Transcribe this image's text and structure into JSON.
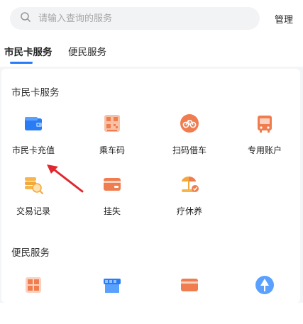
{
  "search": {
    "placeholder": "请输入查询的服务"
  },
  "header": {
    "manage_label": "管理"
  },
  "tabs": [
    {
      "label": "市民卡服务",
      "active": true
    },
    {
      "label": "便民服务",
      "active": false
    }
  ],
  "sections": [
    {
      "title": "市民卡服务",
      "items": [
        {
          "label": "市民卡充值",
          "icon": "wallet-icon"
        },
        {
          "label": "乘车码",
          "icon": "qr-code-icon"
        },
        {
          "label": "扫码借车",
          "icon": "bicycle-icon"
        },
        {
          "label": "专用账户",
          "icon": "bus-icon"
        },
        {
          "label": "交易记录",
          "icon": "coin-search-icon"
        },
        {
          "label": "挂失",
          "icon": "card-icon"
        },
        {
          "label": "疗休养",
          "icon": "beach-icon"
        }
      ]
    },
    {
      "title": "便民服务",
      "items": [
        {
          "label": "",
          "icon": "grid-icon"
        },
        {
          "label": "",
          "icon": "shop-icon"
        },
        {
          "label": "",
          "icon": "card-icon"
        },
        {
          "label": "",
          "icon": "tree-icon"
        }
      ]
    }
  ],
  "colors": {
    "accent": "#2a7cf6",
    "orange": "#f07d4f",
    "annotation_arrow": "#e0282e"
  }
}
